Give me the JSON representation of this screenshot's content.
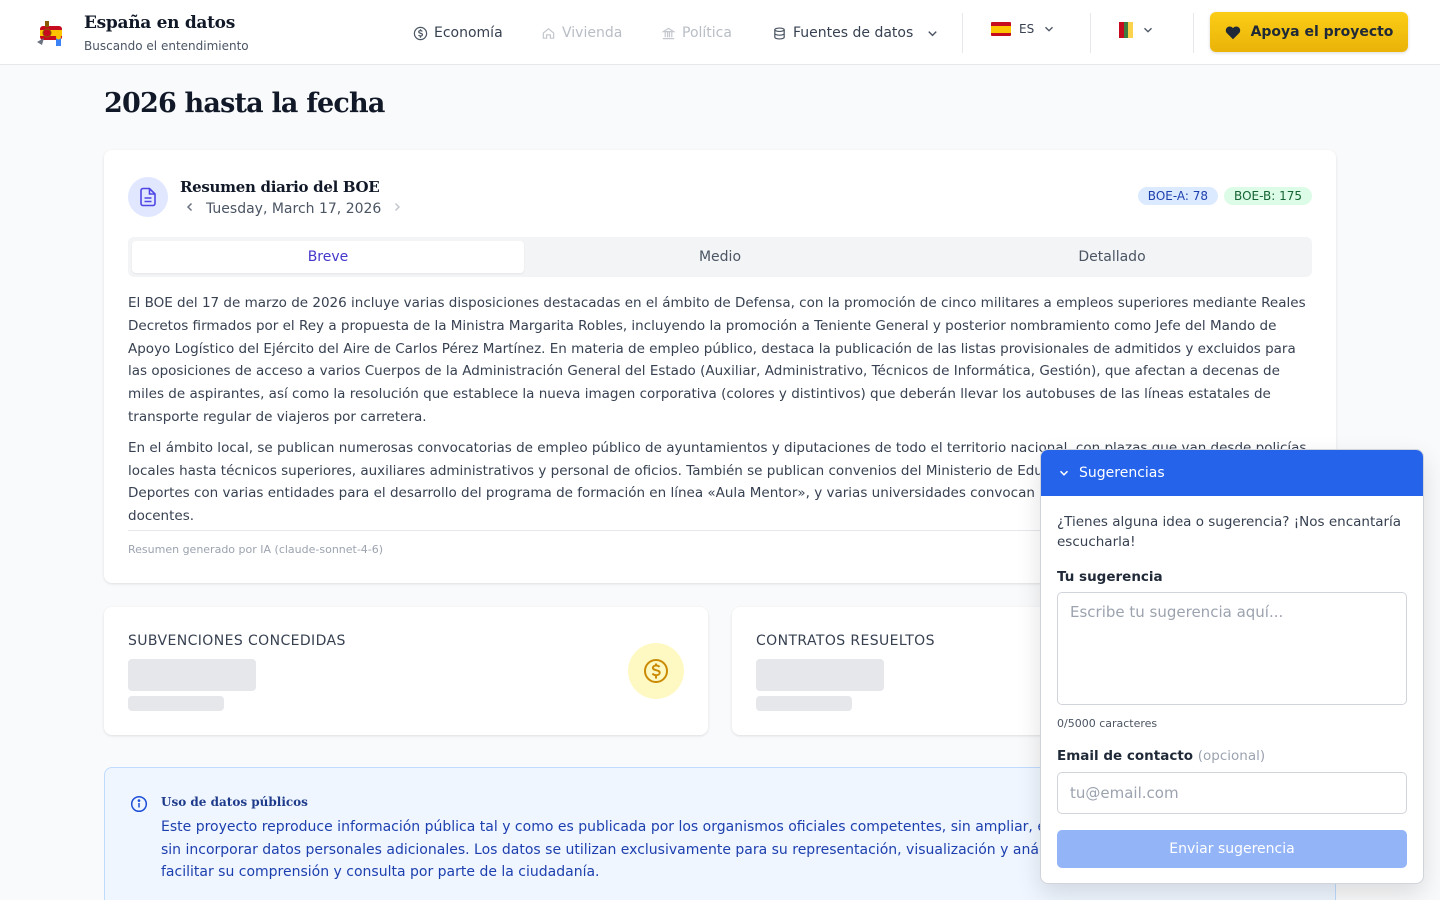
{
  "header": {
    "brand_title": "España en datos",
    "brand_subtitle": "Buscando el entendimiento",
    "nav": [
      {
        "label": "Economía",
        "icon": "dollar-circle-icon",
        "enabled": true
      },
      {
        "label": "Vivienda",
        "icon": "home-icon",
        "enabled": false
      },
      {
        "label": "Política",
        "icon": "landmark-icon",
        "enabled": false
      },
      {
        "label": "Fuentes de datos",
        "icon": "database-icon",
        "enabled": true
      }
    ],
    "language": "ES",
    "support_label": "Apoya el proyecto",
    "colors": {
      "accent": "#eab308",
      "brand": "#2563eb"
    }
  },
  "page": {
    "title": "2026 hasta la fecha"
  },
  "boe": {
    "title": "Resumen diario del BOE",
    "date": "Tuesday, March 17, 2026",
    "badge_a": "BOE-A: 78",
    "badge_b": "BOE-B: 175",
    "tabs": [
      "Breve",
      "Medio",
      "Detallado"
    ],
    "active_tab": "Breve",
    "paragraphs": [
      "El BOE del 17 de marzo de 2026 incluye varias disposiciones destacadas en el ámbito de Defensa, con la promoción de cinco militares a empleos superiores mediante Reales Decretos firmados por el Rey a propuesta de la Ministra Margarita Robles, incluyendo la promoción a Teniente General y posterior nombramiento como Jefe del Mando de Apoyo Logístico del Ejército del Aire de Carlos Pérez Martínez. En materia de empleo público, destaca la publicación de las listas provisionales de admitidos y excluidos para las oposiciones de acceso a varios Cuerpos de la Administración General del Estado (Auxiliar, Administrativo, Técnicos de Informática, Gestión), que afectan a decenas de miles de aspirantes, así como la resolución que establece la nueva imagen corporativa (colores y distintivos) que deberán llevar los autobuses de las líneas estatales de transporte regular de viajeros por carretera.",
      "En el ámbito local, se publican numerosas convocatorias de empleo público de ayuntamientos y diputaciones de todo el territorio nacional, con plazas que van desde policías locales hasta técnicos superiores, auxiliares administrativos y personal de oficios. También se publican convenios del Ministerio de Educación, Formación Profesional y Deportes con varias entidades para el desarrollo del programa de formación en línea «Aula Mentor», y varias universidades convocan concursos para plazas de cuerpos docentes."
    ],
    "ai_note": "Resumen generado por IA (claude-sonnet-4-6)"
  },
  "stats": [
    {
      "label": "SUBVENCIONES CONCEDIDAS",
      "icon": "coin-icon"
    },
    {
      "label": "CONTRATOS RESUELTOS"
    }
  ],
  "info": {
    "title": "Uso de datos públicos",
    "text": "Este proyecto reproduce información pública tal y como es publicada por los organismos oficiales competentes, sin ampliar, enriquecer ni alterar su contenido, y sin incorporar datos personales adicionales. Los datos se utilizan exclusivamente para su representación, visualización y análisis agregado, con el objetivo de facilitar su comprensión y consulta por parte de la ciudadanía."
  },
  "widget": {
    "title": "Sugerencias",
    "intro": "¿Tienes alguna idea o sugerencia? ¡Nos encantaría escucharla!",
    "suggestion_label": "Tu sugerencia",
    "suggestion_placeholder": "Escribe tu sugerencia aquí...",
    "char_count": "0/5000 caracteres",
    "email_label": "Email de contacto",
    "email_optional": "(opcional)",
    "email_placeholder": "tu@email.com",
    "submit_label": "Enviar sugerencia"
  }
}
